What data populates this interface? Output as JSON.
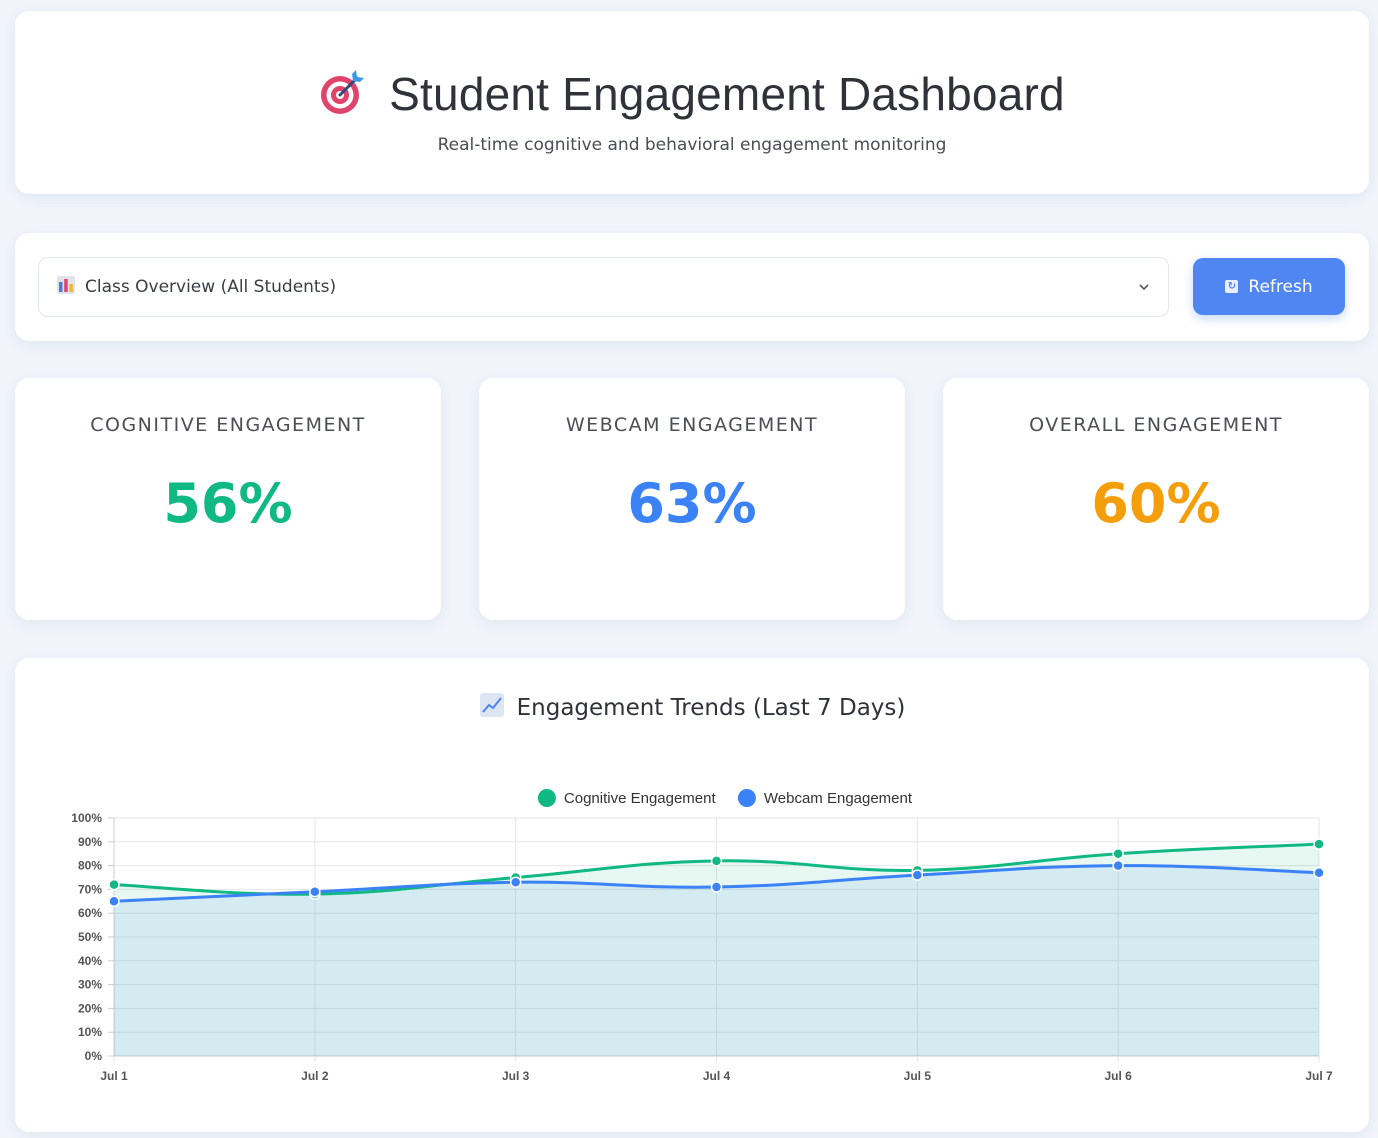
{
  "header": {
    "title": "Student Engagement Dashboard",
    "subtitle": "Real-time cognitive and behavioral engagement monitoring",
    "icon": "target-icon"
  },
  "controls": {
    "select_value": "Class Overview (All Students)",
    "select_icon": "bar-chart-icon",
    "refresh_label": "Refresh",
    "refresh_icon": "refresh-icon"
  },
  "metrics": [
    {
      "label": "COGNITIVE ENGAGEMENT",
      "value": "56%",
      "color": "#10b981"
    },
    {
      "label": "WEBCAM ENGAGEMENT",
      "value": "63%",
      "color": "#3b82f6"
    },
    {
      "label": "OVERALL ENGAGEMENT",
      "value": "60%",
      "color": "#f59e0b"
    }
  ],
  "chart_section": {
    "title": "Engagement Trends (Last 7 Days)",
    "icon": "trend-chart-icon"
  },
  "chart_data": {
    "type": "line",
    "x": [
      "Jul 1",
      "Jul 2",
      "Jul 3",
      "Jul 4",
      "Jul 5",
      "Jul 6",
      "Jul 7"
    ],
    "series": [
      {
        "name": "Cognitive Engagement",
        "values": [
          72,
          68,
          75,
          82,
          78,
          85,
          89
        ],
        "color": "#10b981"
      },
      {
        "name": "Webcam Engagement",
        "values": [
          65,
          69,
          73,
          71,
          76,
          80,
          77
        ],
        "color": "#3b82f6"
      }
    ],
    "ylim": [
      0,
      100
    ],
    "yticks": [
      "0%",
      "10%",
      "20%",
      "30%",
      "40%",
      "50%",
      "60%",
      "70%",
      "80%",
      "90%",
      "100%"
    ],
    "legend": "top",
    "grid": true,
    "fill": true
  }
}
